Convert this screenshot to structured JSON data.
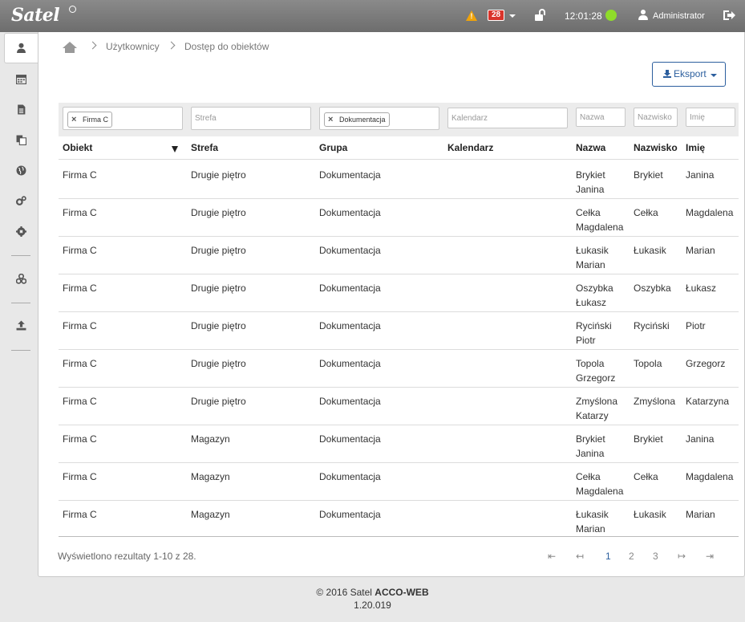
{
  "brand": {
    "logo": "Satel"
  },
  "topbar": {
    "alert_count": "28",
    "time": "12:01:28",
    "user": "Administrator",
    "colors": {
      "warning": "#f0a30a",
      "badge": "#d9342b",
      "status_ok": "#8fdc2a"
    }
  },
  "sidebar": {
    "items": [
      {
        "icon": "user-icon"
      },
      {
        "icon": "calendar-icon"
      },
      {
        "icon": "document-icon"
      },
      {
        "icon": "copy-icon"
      },
      {
        "icon": "globe-icon"
      },
      {
        "icon": "cogs-icon"
      },
      {
        "icon": "gear-icon"
      },
      {
        "icon": "network-icon"
      },
      {
        "icon": "upload-icon"
      }
    ]
  },
  "breadcrumb": {
    "items": [
      "Użytkownicy",
      "Dostęp do obiektów"
    ]
  },
  "toolbar": {
    "export_label": "Eksport"
  },
  "filters": {
    "obiekt_chip": "Firma C",
    "strefa_placeholder": "Strefa",
    "grupa_chip": "Dokumentacja",
    "kalendarz_placeholder": "Kalendarz",
    "nazwa_placeholder": "Nazwa",
    "nazwisko_placeholder": "Nazwisko",
    "imie_placeholder": "Imię"
  },
  "table": {
    "columns": [
      "Obiekt",
      "Strefa",
      "Grupa",
      "Kalendarz",
      "Nazwa",
      "Nazwisko",
      "Imię"
    ],
    "rows": [
      [
        "Firma C",
        "Drugie piętro",
        "Dokumentacja",
        "",
        "Brykiet",
        "Janina",
        "Brykiet",
        "Janina"
      ],
      [
        "Firma C",
        "Drugie piętro",
        "Dokumentacja",
        "",
        "Cełka",
        "Magdalena",
        "Cełka",
        "Magdalena"
      ],
      [
        "Firma C",
        "Drugie piętro",
        "Dokumentacja",
        "",
        "Łukasik",
        "Marian",
        "Łukasik",
        "Marian"
      ],
      [
        "Firma C",
        "Drugie piętro",
        "Dokumentacja",
        "",
        "Oszybka",
        "Łukasz",
        "Oszybka",
        "Łukasz"
      ],
      [
        "Firma C",
        "Drugie piętro",
        "Dokumentacja",
        "",
        "Ryciński",
        "Piotr",
        "Ryciński",
        "Piotr"
      ],
      [
        "Firma C",
        "Drugie piętro",
        "Dokumentacja",
        "",
        "Topola",
        "Grzegorz",
        "Topola",
        "Grzegorz"
      ],
      [
        "Firma C",
        "Drugie piętro",
        "Dokumentacja",
        "",
        "Zmyślona",
        "Katarzy",
        "Zmyślona",
        "Katarzyna"
      ],
      [
        "Firma C",
        "Magazyn",
        "Dokumentacja",
        "",
        "Brykiet",
        "Janina",
        "Brykiet",
        "Janina"
      ],
      [
        "Firma C",
        "Magazyn",
        "Dokumentacja",
        "",
        "Cełka",
        "Magdalena",
        "Cełka",
        "Magdalena"
      ],
      [
        "Firma C",
        "Magazyn",
        "Dokumentacja",
        "",
        "Łukasik",
        "Marian",
        "Łukasik",
        "Marian"
      ]
    ]
  },
  "pagination": {
    "summary": "Wyświetlono rezultaty 1-10 z 28.",
    "first": "⇤",
    "prev": "↤",
    "next": "↦",
    "last": "⇥",
    "pages": [
      "1",
      "2",
      "3"
    ],
    "active_page": "1"
  },
  "footer": {
    "copyright": "© 2016 Satel",
    "product": "ACCO-WEB",
    "version": "1.20.019"
  }
}
